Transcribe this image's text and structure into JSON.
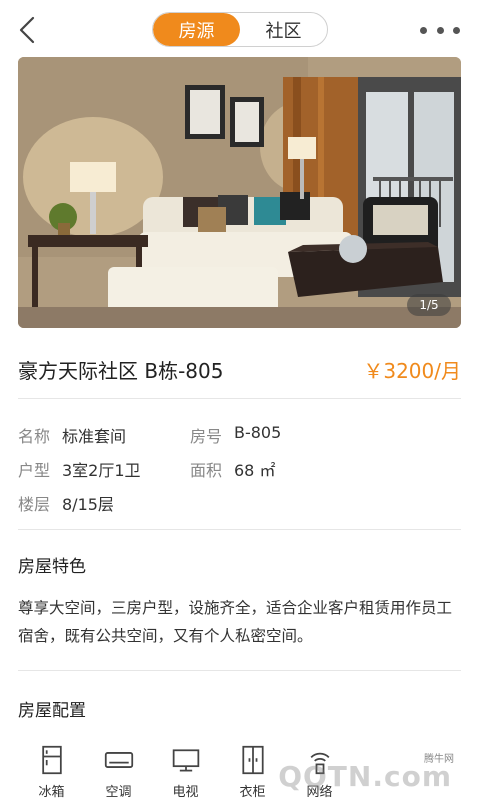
{
  "header": {
    "tabs": [
      {
        "label": "房源",
        "active": true
      },
      {
        "label": "社区",
        "active": false
      }
    ],
    "back_icon": "chevron-left-icon",
    "more_icon": "more-horizontal-icon"
  },
  "gallery": {
    "counter": "1/5"
  },
  "listing": {
    "title": "豪方天际社区 B栋-805",
    "price": "￥3200/月"
  },
  "details": [
    {
      "label": "名称",
      "value": "标准套间"
    },
    {
      "label": "房号",
      "value": "B-805"
    },
    {
      "label": "户型",
      "value": "3室2厅1卫"
    },
    {
      "label": "面积",
      "value": "68 ㎡"
    },
    {
      "label": "楼层",
      "value": "8/15层"
    }
  ],
  "features": {
    "title": "房屋特色",
    "text": "尊享大空间，三房户型，设施齐全，适合企业客户租赁用作员工宿舍，既有公共空间，又有个人私密空间。"
  },
  "config": {
    "title": "房屋配置",
    "items": [
      {
        "label": "冰箱",
        "icon": "fridge-icon"
      },
      {
        "label": "空调",
        "icon": "air-conditioner-icon"
      },
      {
        "label": "电视",
        "icon": "tv-icon"
      },
      {
        "label": "衣柜",
        "icon": "wardrobe-icon"
      },
      {
        "label": "网络",
        "icon": "wifi-icon"
      }
    ]
  },
  "watermark": {
    "small": "腾牛网",
    "big": "QQTN.com"
  },
  "colors": {
    "accent": "#f08a1c",
    "text": "#333333",
    "label": "#888888",
    "divider": "#e6e6e6"
  }
}
